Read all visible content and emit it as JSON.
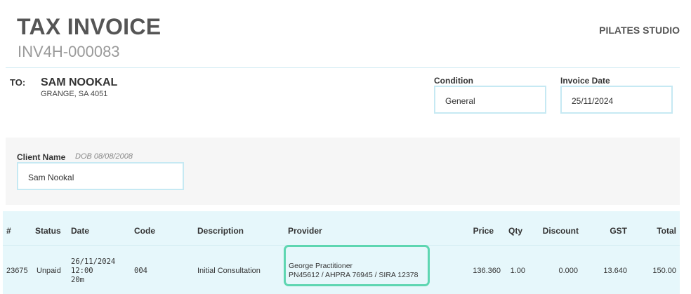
{
  "header": {
    "title": "TAX INVOICE",
    "invoice_number": "INV4H-000083",
    "business_name": "PILATES STUDIO"
  },
  "recipient": {
    "label": "TO:",
    "name": "SAM NOOKAL",
    "address": "GRANGE, SA 4051"
  },
  "condition": {
    "label": "Condition",
    "value": "General"
  },
  "invoice_date": {
    "label": "Invoice Date",
    "value": "25/11/2024"
  },
  "client": {
    "label": "Client Name",
    "dob": "DOB 08/08/2008",
    "value": "Sam Nookal"
  },
  "table": {
    "headers": [
      "#",
      "Status",
      "Date",
      "Code",
      "Description",
      "Provider",
      "Price",
      "Qty",
      "Discount",
      "GST",
      "Total"
    ],
    "rows": [
      {
        "number": "23675",
        "status": "Unpaid",
        "date": "26/11/2024",
        "time": "12:00",
        "duration": "20m",
        "code": "004",
        "description": "Initial Consultation",
        "provider_name": "George Practitioner",
        "provider_ids": "PN45612 / AHPRA 76945 / SIRA 12378",
        "price": "136.360",
        "qty": "1.00",
        "discount": "0.000",
        "gst": "13.640",
        "total": "150.00"
      }
    ]
  },
  "colors": {
    "input_border": "#c6e9f3",
    "table_bg": "#e6f7fb",
    "highlight": "#5ed6b1",
    "panel_bg": "#f6f6f6"
  }
}
